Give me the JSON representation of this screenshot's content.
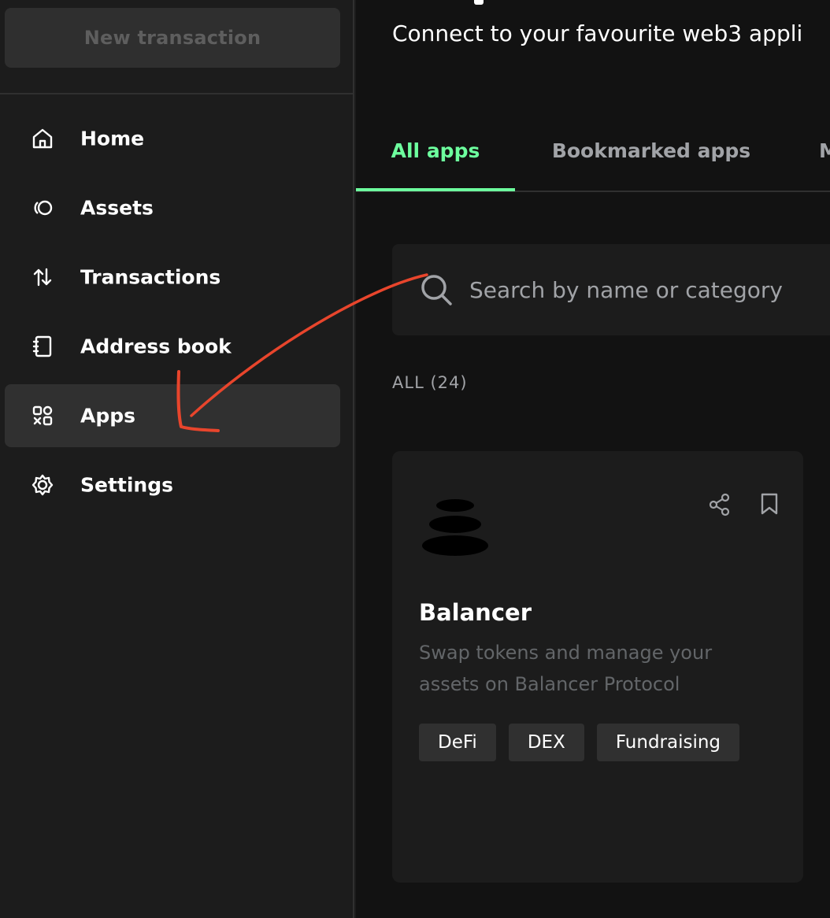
{
  "sidebar": {
    "new_transaction_label": "New transaction",
    "items": [
      {
        "label": "Home",
        "icon": "home-icon"
      },
      {
        "label": "Assets",
        "icon": "assets-icon"
      },
      {
        "label": "Transactions",
        "icon": "transactions-icon"
      },
      {
        "label": "Address book",
        "icon": "address-book-icon"
      },
      {
        "label": "Apps",
        "icon": "apps-icon",
        "active": true
      },
      {
        "label": "Settings",
        "icon": "settings-icon"
      }
    ]
  },
  "main": {
    "subtitle": "Connect to your favourite web3 appli",
    "tabs": [
      {
        "label": "All apps",
        "active": true
      },
      {
        "label": "Bookmarked apps"
      },
      {
        "label": "M"
      }
    ],
    "search": {
      "placeholder": "Search by name or category"
    },
    "count_label": "ALL (24)",
    "app_card": {
      "title": "Balancer",
      "description": "Swap tokens and manage your assets on Balancer Protocol",
      "tags": [
        "DeFi",
        "DEX",
        "Fundraising"
      ]
    }
  },
  "colors": {
    "accent": "#6dff9e",
    "sidebar_bg": "#1c1c1c",
    "main_bg": "#121212",
    "annotation_arrow": "#e8452c"
  }
}
